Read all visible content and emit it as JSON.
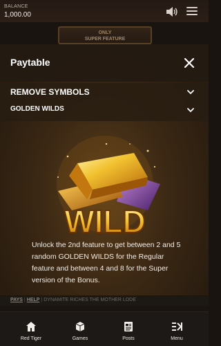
{
  "topbar": {
    "balance_label": "BALANCE",
    "balance_value": "1,000.00",
    "plaque_line1": "ONLY",
    "plaque_line2": "SUPER FEATURE",
    "icons": [
      "speaker-icon",
      "hamburger-icon"
    ]
  },
  "panel": {
    "title": "Paytable",
    "sections": [
      {
        "title": "REMOVE SYMBOLS"
      },
      {
        "title": "GOLDEN WILDS"
      }
    ],
    "wild_label": "WILD",
    "description": "Unlock the 2nd feature to get between 2 and 5 random GOLDEN WILDS for the Regular feature and between 4 and 8 for the Super version of the Bonus."
  },
  "links": {
    "pays": "PAYS",
    "help": "HELP",
    "game_name": "DYNAMITE RICHES THE MOTHER LODE"
  },
  "nav": {
    "items": [
      {
        "label": "Red Tiger",
        "icon": "home-icon"
      },
      {
        "label": "Games",
        "icon": "cube-icon"
      },
      {
        "label": "Posts",
        "icon": "posts-icon"
      },
      {
        "label": "Menu",
        "icon": "menu-icon"
      }
    ]
  },
  "colors": {
    "accent_gold": "#f2c230",
    "panel_dark": "#231a12",
    "nav_bg": "#1c1916"
  }
}
